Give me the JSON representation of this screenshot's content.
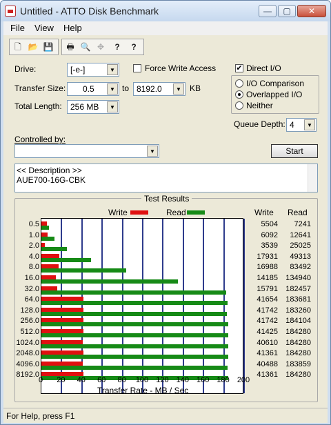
{
  "window": {
    "title": "Untitled - ATTO Disk Benchmark",
    "min": "—",
    "max": "▢",
    "close": "✕"
  },
  "menu": [
    "File",
    "View",
    "Help"
  ],
  "toolbar": [
    {
      "name": "new-icon",
      "glyph": "🗋"
    },
    {
      "name": "open-icon",
      "glyph": "📂"
    },
    {
      "name": "save-icon",
      "glyph": "💾"
    },
    {
      "name": "print-icon",
      "glyph": "🖶"
    },
    {
      "name": "print-preview-icon",
      "glyph": "🔍"
    },
    {
      "name": "move-icon",
      "glyph": "✥"
    },
    {
      "name": "help-icon",
      "glyph": "?"
    },
    {
      "name": "context-help-icon",
      "glyph": "?"
    }
  ],
  "form": {
    "drive_label": "Drive:",
    "drive_value": "[-e-]",
    "force_write_label": "Force Write Access",
    "direct_io_label": "Direct I/O",
    "direct_io_checked": "✔",
    "transfer_size_label": "Transfer Size:",
    "transfer_from": "0.5",
    "to_label": "to",
    "transfer_to": "8192.0",
    "kb_label": "KB",
    "total_length_label": "Total Length:",
    "total_length_value": "256 MB",
    "radio_io_comparison": "I/O Comparison",
    "radio_overlapped": "Overlapped I/O",
    "radio_neither": "Neither",
    "queue_depth_label": "Queue Depth:",
    "queue_depth_value": "4",
    "controlled_by_label": "Controlled by:",
    "controlled_by_value": "",
    "start_label": "Start",
    "description_line1": "<< Description >>",
    "description_line2": "AUE700-16G-CBK"
  },
  "results": {
    "title": "Test Results",
    "write_legend": "Write",
    "read_legend": "Read",
    "write_header": "Write",
    "read_header": "Read",
    "xlabel": "Transfer Rate - MB / Sec",
    "colors": {
      "write": "#e01010",
      "read": "#168a16"
    }
  },
  "chart_data": {
    "type": "bar",
    "orientation": "horizontal",
    "xlabel": "Transfer Rate - MB / Sec",
    "xlim": [
      0,
      200
    ],
    "xticks": [
      "0",
      "20",
      "40",
      "60",
      "80",
      "100",
      "120",
      "140",
      "160",
      "180",
      "200"
    ],
    "categories": [
      "0.5",
      "1.0",
      "2.0",
      "4.0",
      "8.0",
      "16.0",
      "32.0",
      "64.0",
      "128.0",
      "256.0",
      "512.0",
      "1024.0",
      "2048.0",
      "4096.0",
      "8192.0"
    ],
    "write_kb": [
      "5504",
      "6092",
      "3539",
      "17931",
      "16988",
      "14185",
      "15791",
      "41654",
      "41742",
      "41742",
      "41425",
      "40610",
      "41361",
      "40488",
      "41361"
    ],
    "read_kb": [
      "7241",
      "12641",
      "25025",
      "49313",
      "83492",
      "134940",
      "182457",
      "183681",
      "183260",
      "184104",
      "184280",
      "184280",
      "184280",
      "183859",
      "184280"
    ],
    "series": [
      {
        "name": "Write",
        "values": [
          5.5,
          6.1,
          3.5,
          17.9,
          17.0,
          14.2,
          15.8,
          41.7,
          41.7,
          41.7,
          41.4,
          40.6,
          41.4,
          40.5,
          41.4
        ]
      },
      {
        "name": "Read",
        "values": [
          7.2,
          12.6,
          25.0,
          49.3,
          83.5,
          134.9,
          182.5,
          183.7,
          183.3,
          184.1,
          184.3,
          184.3,
          184.3,
          183.9,
          184.3
        ]
      }
    ]
  },
  "status": {
    "text": "For Help, press F1"
  }
}
